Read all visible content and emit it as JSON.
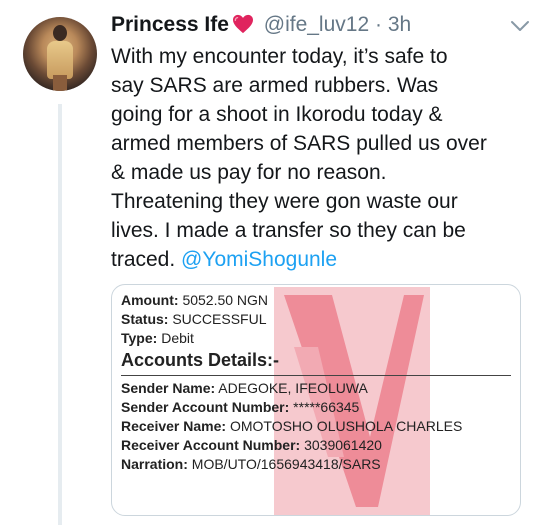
{
  "tweet": {
    "author_name": "Princess Ife",
    "handle": "@ife_luv12",
    "separator": "·",
    "time": "3h",
    "text_lines": [
      "With my encounter today, it’s safe to",
      "say SARS are armed rubbers. Was",
      "going for a shoot in Ikorodu today &",
      "armed members of SARS pulled us over",
      "& made us pay for no reason.",
      "Threatening they were gon waste our",
      "lives. I made a transfer so they can be",
      "traced."
    ],
    "mention": "@YomiShogunle"
  },
  "receipt": {
    "amount_label": "Amount:",
    "amount_value": "5052.50 NGN",
    "status_label": "Status:",
    "status_value": "SUCCESSFUL",
    "type_label": "Type:",
    "type_value": "Debit",
    "section_title": "Accounts Details:-",
    "sender_name_label": "Sender Name:",
    "sender_name_value": "ADEGOKE, IFEOLUWA",
    "sender_account_label": "Sender Account Number:",
    "sender_account_value": "*****66345",
    "receiver_name_label": "Receiver Name:",
    "receiver_name_value": "OMOTOSHO OLUSHOLA CHARLES",
    "receiver_account_label": "Receiver Account Number:",
    "receiver_account_value": "3039061420",
    "narration_label": "Narration:",
    "narration_value": "MOB/UTO/1656943418/SARS"
  },
  "colors": {
    "link": "#1da1f2",
    "muted": "#657786",
    "heart": "#e0245e",
    "watermark": "#e8384f"
  },
  "icons": [
    "avatar-photo",
    "red-heart-icon",
    "chevron-down-icon",
    "bank-logo-watermark"
  ]
}
